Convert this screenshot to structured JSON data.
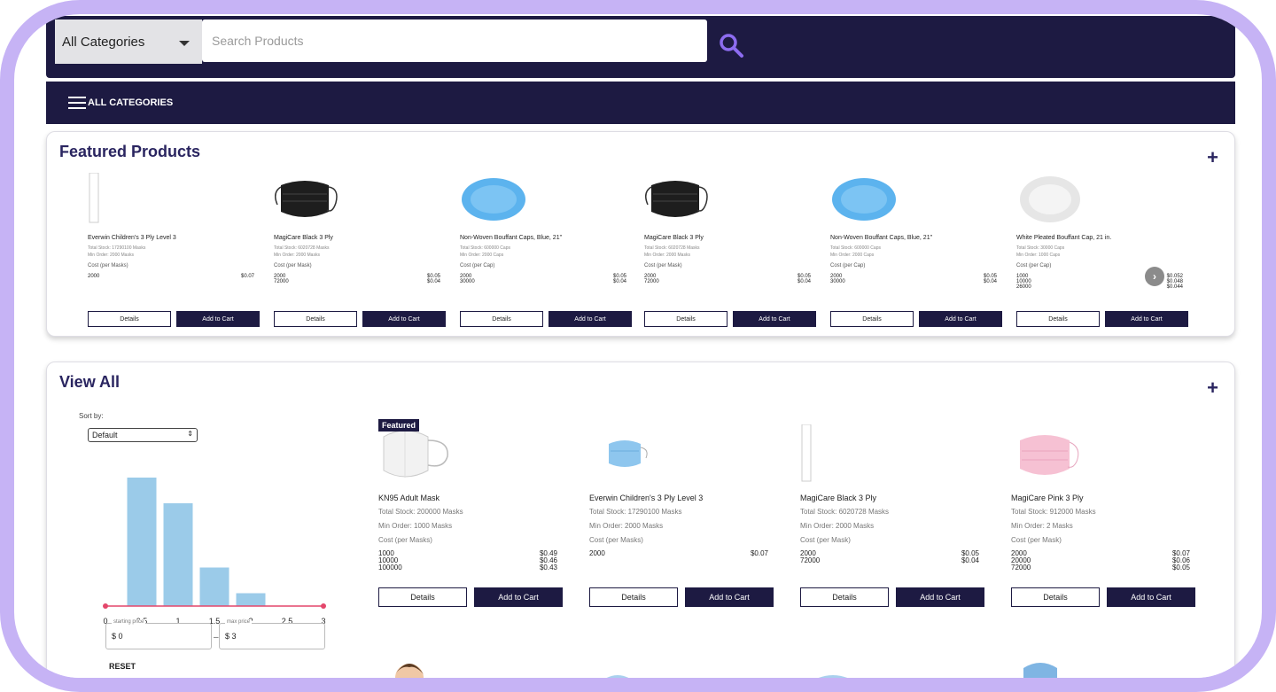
{
  "header": {
    "category_select": "All Categories",
    "search_placeholder": "Search Products",
    "nav_label": "ALL CATEGORIES"
  },
  "featured": {
    "title": "Featured Products",
    "items": [
      {
        "name": "Everwin Children's 3 Ply Level 3",
        "stock": "Total Stock: 17290100 Masks",
        "min": "Min Order: 2000 Masks",
        "cost_label": "Cost (per Masks)",
        "tiers": [
          [
            "2000",
            "$0.07"
          ]
        ],
        "icon": "blank-icon"
      },
      {
        "name": "MagiCare Black 3 Ply",
        "stock": "Total Stock: 6020728 Masks",
        "min": "Min Order: 2000 Masks",
        "cost_label": "Cost (per Mask)",
        "tiers": [
          [
            "2000",
            "$0.05"
          ],
          [
            "72000",
            "$0.04"
          ]
        ],
        "icon": "black-mask-icon"
      },
      {
        "name": "Non-Woven Bouffant Caps, Blue, 21\"",
        "stock": "Total Stock: 600000 Caps",
        "min": "Min Order: 2000 Caps",
        "cost_label": "Cost (per Cap)",
        "tiers": [
          [
            "2000",
            "$0.05"
          ],
          [
            "30000",
            "$0.04"
          ]
        ],
        "icon": "blue-cap-icon"
      },
      {
        "name": "MagiCare Black 3 Ply",
        "stock": "Total Stock: 6020728 Masks",
        "min": "Min Order: 2000 Masks",
        "cost_label": "Cost (per Mask)",
        "tiers": [
          [
            "2000",
            "$0.05"
          ],
          [
            "72000",
            "$0.04"
          ]
        ],
        "icon": "black-mask-icon"
      },
      {
        "name": "Non-Woven Bouffant Caps, Blue, 21\"",
        "stock": "Total Stock: 600000 Caps",
        "min": "Min Order: 2000 Caps",
        "cost_label": "Cost (per Cap)",
        "tiers": [
          [
            "2000",
            "$0.05"
          ],
          [
            "30000",
            "$0.04"
          ]
        ],
        "icon": "blue-cap-icon"
      },
      {
        "name": "White Pleated Bouffant Cap, 21 in.",
        "stock": "Total Stock: 30000 Caps",
        "min": "Min Order: 1000 Caps",
        "cost_label": "Cost (per Cap)",
        "tiers": [
          [
            "1000",
            "$0.052"
          ],
          [
            "10000",
            "$0.048"
          ],
          [
            "26000",
            "$0.044"
          ]
        ],
        "icon": "white-cap-icon"
      }
    ],
    "details_label": "Details",
    "add_label": "Add to Cart"
  },
  "viewall": {
    "title": "View All",
    "sort_label": "Sort by:",
    "sort_value": "Default",
    "items": [
      {
        "name": "KN95 Adult Mask",
        "stock": "Total Stock: 200000 Masks",
        "min": "Min Order: 1000 Masks",
        "cost_label": "Cost (per Masks)",
        "tiers": [
          [
            "1000",
            "$0.49"
          ],
          [
            "10000",
            "$0.46"
          ],
          [
            "100000",
            "$0.43"
          ]
        ],
        "badge": "Featured",
        "icon": "kn95-mask-icon"
      },
      {
        "name": "Everwin Children's 3 Ply Level 3",
        "stock": "Total Stock: 17290100 Masks",
        "min": "Min Order: 2000 Masks",
        "cost_label": "Cost (per Masks)",
        "tiers": [
          [
            "2000",
            "$0.07"
          ]
        ],
        "badge": "",
        "icon": "blue-mask-icon"
      },
      {
        "name": "MagiCare Black 3 Ply",
        "stock": "Total Stock: 6020728 Masks",
        "min": "Min Order: 2000 Masks",
        "cost_label": "Cost (per Mask)",
        "tiers": [
          [
            "2000",
            "$0.05"
          ],
          [
            "72000",
            "$0.04"
          ]
        ],
        "badge": "",
        "icon": "blank-icon"
      },
      {
        "name": "MagiCare Pink 3 Ply",
        "stock": "Total Stock: 912000 Masks",
        "min": "Min Order: 2 Masks",
        "cost_label": "Cost (per Mask)",
        "tiers": [
          [
            "2000",
            "$0.07"
          ],
          [
            "20000",
            "$0.06"
          ],
          [
            "72000",
            "$0.05"
          ]
        ],
        "badge": "",
        "icon": "pink-mask-icon"
      }
    ],
    "details_label": "Details",
    "add_label": "Add to Cart",
    "price_filter": {
      "start_label": "starting price",
      "start_value": "$ 0",
      "max_label": "max price",
      "max_value": "$ 3",
      "reset_label": "RESET"
    },
    "chart_data": {
      "type": "bar",
      "x_ticks": [
        "0",
        "0.5",
        "1",
        "1.5",
        "2",
        "2.5",
        "3"
      ],
      "bins": [
        [
          0.25,
          0.75
        ],
        [
          0.75,
          1.25
        ],
        [
          1.25,
          1.75
        ],
        [
          1.75,
          2.25
        ]
      ],
      "values": [
        10,
        8,
        3,
        1
      ],
      "xlim": [
        0,
        3
      ],
      "range": [
        0,
        3
      ]
    }
  }
}
